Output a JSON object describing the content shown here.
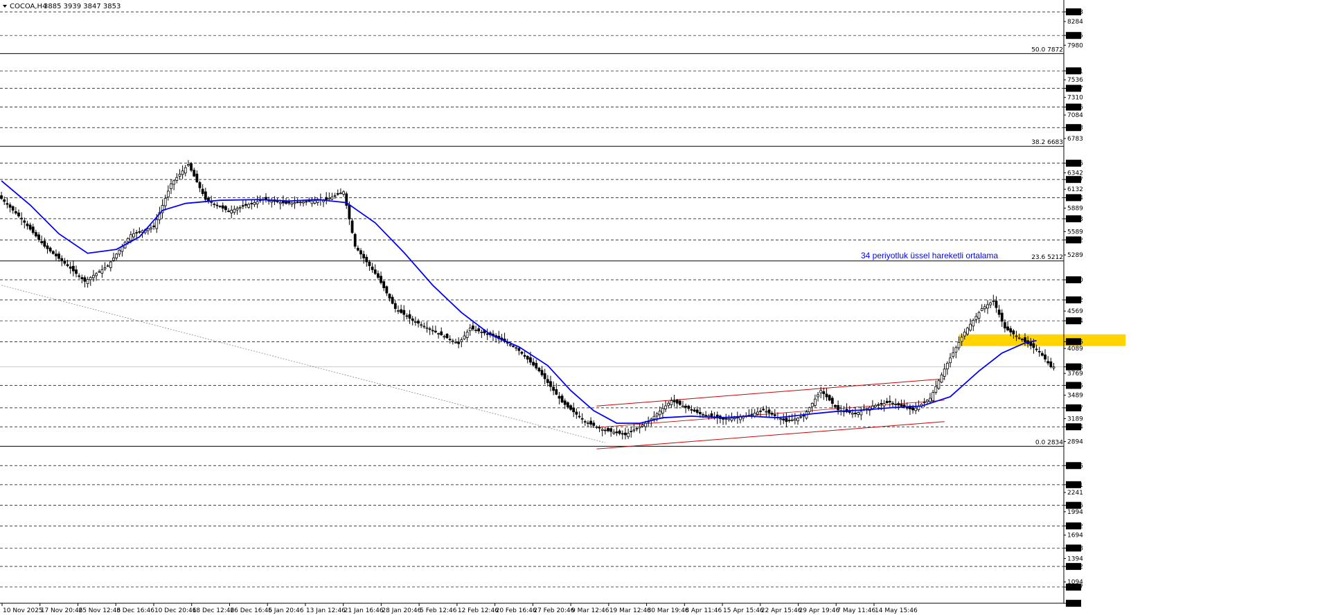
{
  "header": {
    "symbol": "COCOA,H4",
    "ohlc": "3885 3939 3847 3853"
  },
  "annotation": {
    "text": "34 periyotluk üssel hareketli ortalama"
  },
  "colors": {
    "ema": "#0000ff",
    "channel": "#cc0000",
    "zone": "#ffd400",
    "candle": "#000000",
    "grid": "#000000"
  },
  "chart_data": {
    "type": "candlestick",
    "ylim": [
      820,
      8560
    ],
    "price_labels": [
      8408,
      8284,
      8105,
      7980,
      7651,
      7536,
      7427,
      7310,
      7186,
      7084,
      6923,
      6783,
      6466,
      6342,
      6257,
      6132,
      6024,
      5889,
      5753,
      5589,
      5482,
      5289,
      4970,
      4712,
      4569,
      4444,
      4176,
      4089,
      3853,
      3769,
      3615,
      3489,
      3327,
      3189,
      3084,
      2894,
      2586,
      2341,
      2241,
      2076,
      1994,
      1812,
      1694,
      1528,
      1394,
      1292,
      1094,
      1027,
      819
    ],
    "boxed_labels": [
      8408,
      8105,
      7651,
      7427,
      7186,
      6923,
      6466,
      6257,
      6024,
      5753,
      5482,
      4970,
      4712,
      4444,
      4176,
      3853,
      3615,
      3327,
      3084,
      2586,
      2341,
      2076,
      1812,
      1528,
      1292,
      1027,
      819
    ],
    "dashed_levels": [
      8408,
      8105,
      7651,
      7427,
      7186,
      6923,
      6466,
      6257,
      6024,
      5753,
      5482,
      4970,
      4712,
      4444,
      4176,
      3615,
      3327,
      3084,
      2586,
      2341,
      2076,
      1812,
      1528,
      1292,
      1027
    ],
    "current_price": 3853,
    "fibonacci": [
      {
        "label": "50.0 7872",
        "value": 7872
      },
      {
        "label": "38.2 6683",
        "value": 6683
      },
      {
        "label": "23.6 5212",
        "value": 5212
      },
      {
        "label": "0.0 2834",
        "value": 2834
      }
    ],
    "time_labels": [
      "10 Nov 2025",
      "17 Nov 20:46",
      "25 Nov 12:46",
      "3 Dec 16:46",
      "10 Dec 20:46",
      "18 Dec 12:46",
      "26 Dec 16:46",
      "5 Jan 20:46",
      "13 Jan 12:46",
      "21 Jan 16:46",
      "28 Jan 20:46",
      "5 Feb 12:46",
      "12 Feb 12:46",
      "20 Feb 16:46",
      "27 Feb 20:46",
      "9 Mar 12:46",
      "19 Mar 12:46",
      "30 Mar 19:46",
      "8 Apr 11:46",
      "15 Apr 15:46",
      "22 Apr 15:46",
      "29 Apr 19:46",
      "7 May 11:46",
      "14 May 15:46"
    ],
    "price_path": [
      [
        0,
        6050
      ],
      [
        8,
        5750
      ],
      [
        16,
        5400
      ],
      [
        24,
        5150
      ],
      [
        30,
        4950
      ],
      [
        38,
        5150
      ],
      [
        46,
        5550
      ],
      [
        54,
        5650
      ],
      [
        60,
        6200
      ],
      [
        66,
        6450
      ],
      [
        72,
        6000
      ],
      [
        80,
        5850
      ],
      [
        92,
        6000
      ],
      [
        100,
        5950
      ],
      [
        114,
        6000
      ],
      [
        120,
        6100
      ],
      [
        124,
        5400
      ],
      [
        132,
        5000
      ],
      [
        138,
        4600
      ],
      [
        144,
        4450
      ],
      [
        152,
        4300
      ],
      [
        160,
        4150
      ],
      [
        164,
        4350
      ],
      [
        172,
        4250
      ],
      [
        180,
        4100
      ],
      [
        188,
        3800
      ],
      [
        196,
        3400
      ],
      [
        204,
        3150
      ],
      [
        210,
        3050
      ],
      [
        218,
        2980
      ],
      [
        226,
        3150
      ],
      [
        234,
        3420
      ],
      [
        244,
        3250
      ],
      [
        252,
        3180
      ],
      [
        260,
        3220
      ],
      [
        266,
        3300
      ],
      [
        274,
        3150
      ],
      [
        280,
        3220
      ],
      [
        286,
        3550
      ],
      [
        292,
        3300
      ],
      [
        298,
        3250
      ],
      [
        304,
        3350
      ],
      [
        310,
        3400
      ],
      [
        318,
        3300
      ],
      [
        324,
        3450
      ],
      [
        330,
        3900
      ],
      [
        336,
        4300
      ],
      [
        342,
        4600
      ],
      [
        346,
        4700
      ],
      [
        350,
        4350
      ],
      [
        356,
        4200
      ],
      [
        362,
        4050
      ],
      [
        366,
        3853
      ]
    ],
    "ema34": [
      [
        0,
        6240
      ],
      [
        10,
        5930
      ],
      [
        20,
        5560
      ],
      [
        30,
        5310
      ],
      [
        40,
        5360
      ],
      [
        48,
        5520
      ],
      [
        56,
        5860
      ],
      [
        64,
        5950
      ],
      [
        76,
        5990
      ],
      [
        90,
        6000
      ],
      [
        100,
        5980
      ],
      [
        110,
        6000
      ],
      [
        120,
        5960
      ],
      [
        130,
        5700
      ],
      [
        140,
        5320
      ],
      [
        150,
        4900
      ],
      [
        160,
        4550
      ],
      [
        170,
        4270
      ],
      [
        180,
        4110
      ],
      [
        190,
        3870
      ],
      [
        198,
        3550
      ],
      [
        206,
        3290
      ],
      [
        214,
        3130
      ],
      [
        222,
        3130
      ],
      [
        230,
        3200
      ],
      [
        240,
        3220
      ],
      [
        250,
        3200
      ],
      [
        260,
        3220
      ],
      [
        270,
        3200
      ],
      [
        282,
        3250
      ],
      [
        290,
        3280
      ],
      [
        300,
        3300
      ],
      [
        310,
        3330
      ],
      [
        320,
        3350
      ],
      [
        330,
        3470
      ],
      [
        340,
        3800
      ],
      [
        348,
        4030
      ],
      [
        356,
        4160
      ],
      [
        360,
        4190
      ]
    ],
    "channel_upper": [
      [
        207,
        3350
      ],
      [
        328,
        3700
      ]
    ],
    "channel_lower": [
      [
        207,
        2800
      ],
      [
        328,
        3150
      ]
    ],
    "dotted_trend": [
      [
        0,
        4900
      ],
      [
        210,
        2880
      ]
    ],
    "resistance_zone": {
      "range": [
        4120,
        4270
      ],
      "x": [
        333,
        391
      ]
    }
  }
}
